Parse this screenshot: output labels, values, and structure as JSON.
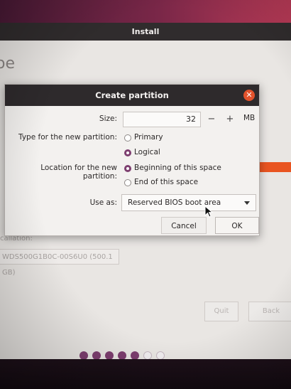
{
  "installer": {
    "title": "Install",
    "heading_fragment": "oe",
    "installation_label": "callation:",
    "device": "WDS500G1B0C-00S6U0 (500.1 GB)",
    "quit_label": "Quit",
    "back_label": "Back",
    "progress": {
      "total_steps": 7,
      "completed_steps": 5
    }
  },
  "dialog": {
    "title": "Create partition",
    "close_glyph": "✕",
    "size_label": "Size:",
    "size_value": "32",
    "size_minus": "−",
    "size_plus": "+",
    "size_unit": "MB",
    "type_label": "Type for the new partition:",
    "type_options": [
      {
        "label": "Primary",
        "selected": false
      },
      {
        "label": "Logical",
        "selected": true
      }
    ],
    "location_label": "Location for the new partition:",
    "location_options": [
      {
        "label": "Beginning of this space",
        "selected": true
      },
      {
        "label": "End of this space",
        "selected": false
      }
    ],
    "use_as_label": "Use as:",
    "use_as_value": "Reserved BIOS boot area",
    "cancel_label": "Cancel",
    "ok_label": "OK"
  },
  "colors": {
    "accent": "#7d3e6f",
    "titlebar": "#2e2a2c",
    "close_button": "#e2522c",
    "orange_accent": "#e95420"
  },
  "icons": [
    "close-icon",
    "chevron-down-icon",
    "mouse-cursor-icon"
  ]
}
